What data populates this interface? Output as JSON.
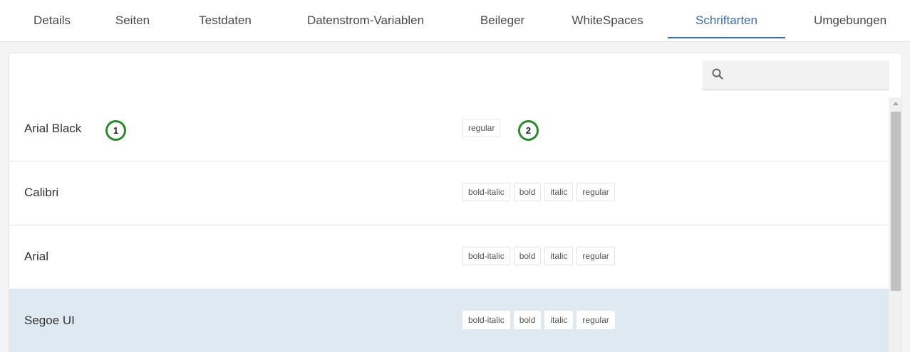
{
  "tabs": [
    {
      "label": "Details"
    },
    {
      "label": "Seiten"
    },
    {
      "label": "Testdaten"
    },
    {
      "label": "Datenstrom-Variablen"
    },
    {
      "label": "Beileger"
    },
    {
      "label": "WhiteSpaces"
    },
    {
      "label": "Schriftarten",
      "active": true
    },
    {
      "label": "Umgebungen"
    }
  ],
  "search": {
    "placeholder": "",
    "value": ""
  },
  "fonts": [
    {
      "name": "Arial Black",
      "variants": [
        "regular"
      ]
    },
    {
      "name": "Calibri",
      "variants": [
        "bold-italic",
        "bold",
        "italic",
        "regular"
      ]
    },
    {
      "name": "Arial",
      "variants": [
        "bold-italic",
        "bold",
        "italic",
        "regular"
      ]
    },
    {
      "name": "Segoe UI",
      "variants": [
        "bold-italic",
        "bold",
        "italic",
        "regular"
      ],
      "selected": true
    }
  ],
  "markers": [
    "1",
    "2"
  ],
  "colors": {
    "accent": "#3b6ea8",
    "selected_row": "#dfe9f1",
    "marker": "#2b8a2b"
  }
}
